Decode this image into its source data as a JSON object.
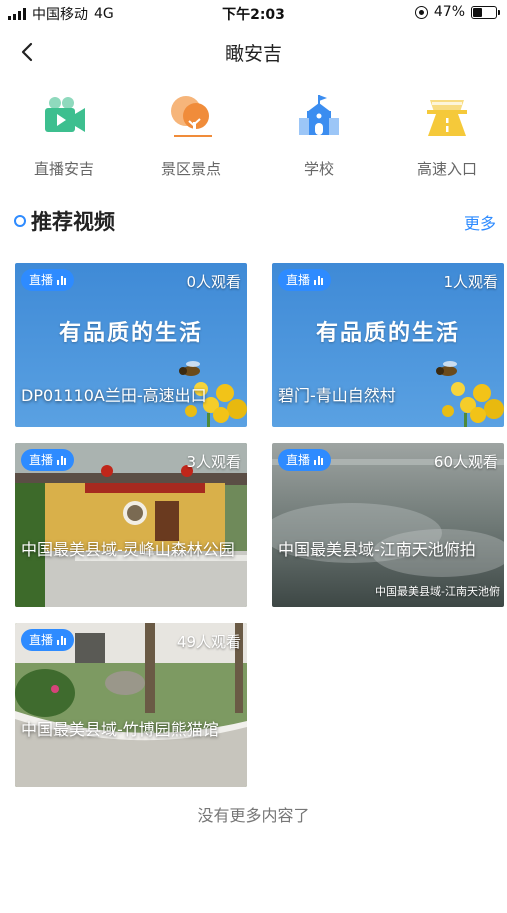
{
  "status_bar": {
    "carrier": "中国移动",
    "network": "4G",
    "time": "下午2:03",
    "battery_pct": "47%",
    "battery_level": 0.47
  },
  "nav": {
    "title": "瞰安吉",
    "back_icon": "chevron-left-icon"
  },
  "categories": [
    {
      "label": "直播安吉",
      "icon": "video-camera-icon",
      "color": "#3dbf8f"
    },
    {
      "label": "景区景点",
      "icon": "tree-icon",
      "color": "#f08c3a"
    },
    {
      "label": "学校",
      "icon": "school-icon",
      "color": "#3b8df0"
    },
    {
      "label": "高速入口",
      "icon": "highway-icon",
      "color": "#f5c93a"
    }
  ],
  "section": {
    "title": "推荐视频",
    "more": "更多"
  },
  "videos": [
    {
      "badge": "直播",
      "viewers": "0人观看",
      "title": "DP01110A兰田-高速出口",
      "banner": "有品质的生活",
      "watermark": ""
    },
    {
      "badge": "直播",
      "viewers": "1人观看",
      "title": "碧门-青山自然村",
      "banner": "有品质的生活",
      "watermark": ""
    },
    {
      "badge": "直播",
      "viewers": "3人观看",
      "title": "中国最美县域-灵峰山森林公园",
      "banner": "",
      "watermark": ""
    },
    {
      "badge": "直播",
      "viewers": "60人观看",
      "title": "中国最美县域-江南天池俯拍",
      "banner": "",
      "watermark": "中国最美县域-江南天池俯"
    },
    {
      "badge": "直播",
      "viewers": "49人观看",
      "title": "中国最美县域-竹博园熊猫馆",
      "banner": "",
      "watermark": ""
    }
  ],
  "footer_note": "没有更多内容了",
  "colors": {
    "accent": "#2e8bff"
  }
}
